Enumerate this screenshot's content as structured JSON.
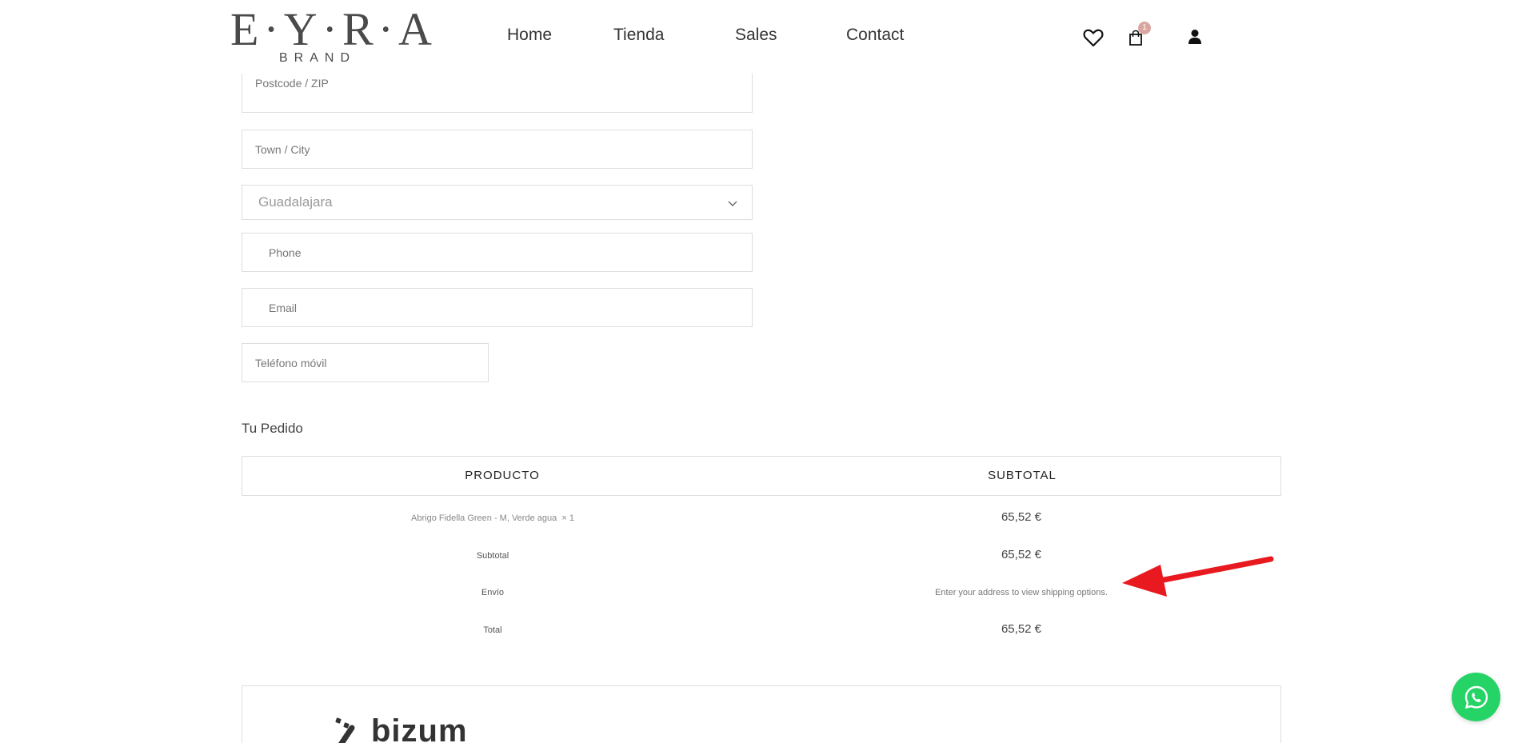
{
  "header": {
    "logo_main": "E·Y·R·A",
    "logo_sub": "BRAND",
    "nav": [
      {
        "label": "Home"
      },
      {
        "label": "Tienda"
      },
      {
        "label": "Sales"
      },
      {
        "label": "Contact"
      }
    ],
    "icons": {
      "wishlist": "heart-icon",
      "cart": "shopping-bag-icon",
      "account": "user-icon"
    },
    "cart_count": "1",
    "badge_color": "#d9a6a0"
  },
  "form": {
    "postcode_placeholder": "Postcode / ZIP",
    "city_placeholder": "Town / City",
    "state_value": "Guadalajara",
    "phone_placeholder": "Phone",
    "email_placeholder": "Email",
    "mobile_placeholder": "Teléfono móvil"
  },
  "order": {
    "title": "Tu Pedido",
    "columns": {
      "product": "PRODUCTO",
      "subtotal": "SUBTOTAL"
    },
    "item": {
      "name": "Abrigo Fidella Green - M, Verde agua",
      "qty": "× 1",
      "price": "65,52 €"
    },
    "subtotal": {
      "label": "Subtotal",
      "value": "65,52 €"
    },
    "shipping": {
      "label": "Envío",
      "value": "Enter your address to view shipping options."
    },
    "total": {
      "label": "Total",
      "value": "65,52 €"
    }
  },
  "payment": {
    "method": "bizum"
  },
  "colors": {
    "accent_arrow": "#e8191f",
    "whatsapp": "#25d366"
  }
}
